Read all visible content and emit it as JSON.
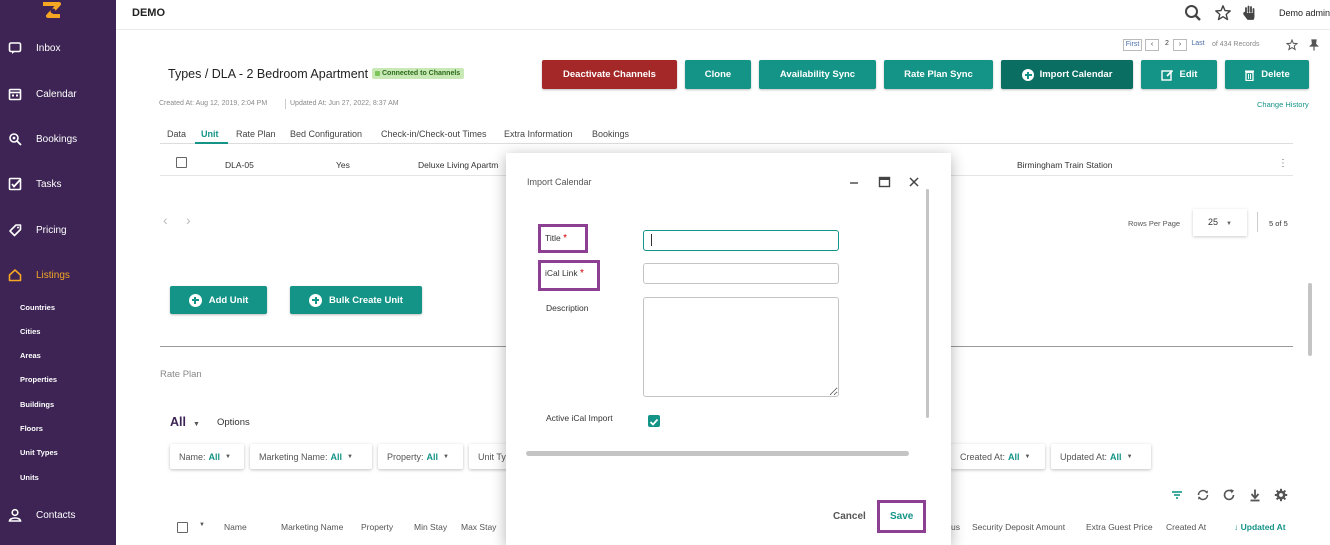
{
  "sidebar": {
    "items": [
      {
        "label": "Inbox",
        "icon": "inbox-icon"
      },
      {
        "label": "Calendar",
        "icon": "calendar-icon"
      },
      {
        "label": "Bookings",
        "icon": "bookings-icon"
      },
      {
        "label": "Tasks",
        "icon": "tasks-icon"
      },
      {
        "label": "Pricing",
        "icon": "tag-icon"
      },
      {
        "label": "Listings",
        "icon": "home-icon"
      },
      {
        "label": "Contacts",
        "icon": "user-icon"
      }
    ],
    "subitems": [
      "Countries",
      "Cities",
      "Areas",
      "Properties",
      "Buildings",
      "Floors",
      "Unit Types",
      "Units"
    ]
  },
  "topbar": {
    "brand": "DEMO",
    "user": "Demo admin"
  },
  "pager": {
    "first": "First",
    "page": "2",
    "last": "Last",
    "records": "of 434 Records"
  },
  "page": {
    "breadcrumb": "Types / DLA - 2 Bedroom Apartment",
    "badge": "Connected to Channels",
    "created": "Created At: Aug 12, 2019, 2:04 PM",
    "updated": "Updated At: Jun 27, 2022, 8:37 AM",
    "change_history": "Change History"
  },
  "actions": {
    "deactivate": "Deactivate Channels",
    "clone": "Clone",
    "availability_sync": "Availability Sync",
    "rate_plan_sync": "Rate Plan Sync",
    "import_calendar": "Import Calendar",
    "edit": "Edit",
    "delete": "Delete"
  },
  "tabs": [
    "Data",
    "Unit",
    "Rate Plan",
    "Bed Configuration",
    "Check-in/Check-out Times",
    "Extra Information",
    "Bookings"
  ],
  "unit_row": {
    "code": "DLA-05",
    "flag": "Yes",
    "name": "Deluxe Living Apartm",
    "station": "Birmingham Train Station"
  },
  "pagination": {
    "rows_label": "Rows Per Page",
    "rows_value": "25",
    "range": "5 of 5"
  },
  "unit_buttons": {
    "add": "Add Unit",
    "bulk": "Bulk Create Unit"
  },
  "rate_plan": {
    "section": "Rate Plan",
    "all": "All",
    "options": "Options",
    "filters": [
      {
        "label": "Name:",
        "value": "All"
      },
      {
        "label": "Marketing Name:",
        "value": "All"
      },
      {
        "label": "Property:",
        "value": "All"
      },
      {
        "label": "Unit Ty",
        "value": ""
      },
      {
        "label": "Created At:",
        "value": "All"
      },
      {
        "label": "Updated At:",
        "value": "All"
      }
    ],
    "columns": [
      "Name",
      "Marketing Name",
      "Property",
      "Min Stay",
      "Max Stay",
      "us",
      "Security Deposit Amount",
      "Extra Guest Price",
      "Created At",
      "Updated At"
    ]
  },
  "modal": {
    "title": "Import Calendar",
    "title_label": "Title",
    "required_mark": "*",
    "ical_label": "iCal Link",
    "description_label": "Description",
    "active_label": "Active iCal Import",
    "title_value": "",
    "ical_value": "",
    "description_value": "",
    "active_checked": true,
    "cancel": "Cancel",
    "save": "Save"
  },
  "colors": {
    "sidebar": "#3d2454",
    "teal": "#149487",
    "dark_teal": "#0b6e63",
    "red": "#a42828",
    "highlight": "#8d3f93",
    "active_nav": "#f5a623"
  }
}
